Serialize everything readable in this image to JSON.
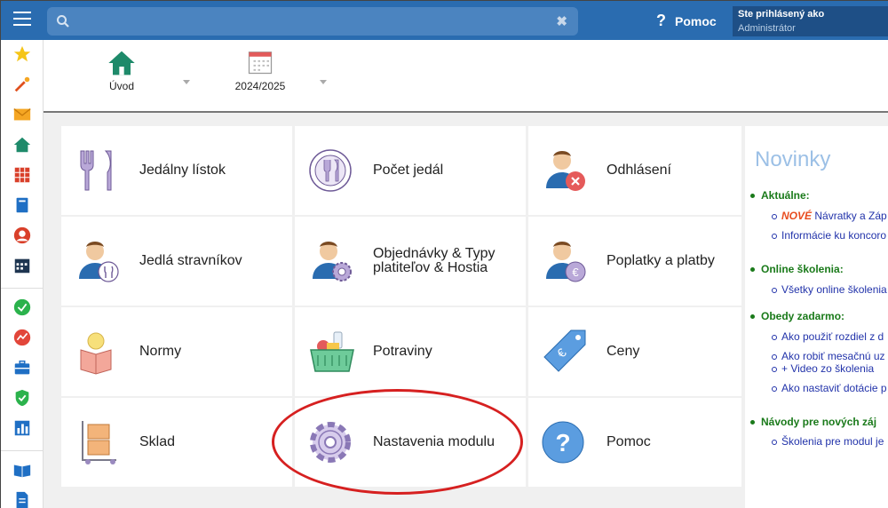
{
  "topbar": {
    "search_placeholder": "",
    "help_label": "Pomoc",
    "user_line1": "Ste prihlásený ako",
    "user_line2": "Administrátor"
  },
  "sidebar": {
    "icons": [
      "star-icon",
      "magic-wand-icon",
      "mail-icon",
      "home-icon",
      "grid-icon",
      "book-icon",
      "person-icon",
      "calendar-icon",
      "check-circle-icon",
      "chart-circle-icon",
      "briefcase-icon",
      "shield-check-icon",
      "bar-chart-icon",
      "open-book-icon",
      "document-icon"
    ]
  },
  "toolbar": {
    "items": [
      {
        "label": "Úvod"
      },
      {
        "label": "2024/2025"
      }
    ]
  },
  "tiles": [
    {
      "label": "Jedálny lístok"
    },
    {
      "label": "Počet jedál"
    },
    {
      "label": "Odhlásení"
    },
    {
      "label": "Jedlá stravníkov"
    },
    {
      "label": "Objednávky & Typy"
    },
    {
      "label": "platiteľov & Hostia"
    },
    {
      "label": "Poplatky a platby"
    },
    {
      "label": "Normy"
    },
    {
      "label": "Potraviny"
    },
    {
      "label": "Ceny"
    },
    {
      "label": "Sklad"
    },
    {
      "label": "Nastavenia modulu"
    },
    {
      "label": "Pomoc"
    }
  ],
  "news": {
    "title": "Novinky",
    "sections": [
      {
        "title": "Aktuálne:",
        "links": [
          {
            "badge": "NOVÉ",
            "text": "Návratky a Záp"
          },
          {
            "text": "Informácie ku koncoro"
          }
        ]
      },
      {
        "title": "Online školenia:",
        "links": [
          {
            "text": "Všetky online školenia"
          }
        ]
      },
      {
        "title": "Obedy zadarmo:",
        "links": [
          {
            "text": "Ako použiť rozdiel z d"
          },
          {
            "text": "Ako robiť mesačnú uz"
          },
          {
            "text": "+ Video zo školenia"
          },
          {
            "text": "Ako nastaviť dotácie p"
          }
        ]
      },
      {
        "title": "Návody pre nových záj",
        "links": [
          {
            "text": "Školenia pre modul je"
          }
        ]
      }
    ]
  },
  "colors": {
    "topbar": "#2a6cb0",
    "accent_green": "#1a7a1a",
    "link_blue": "#2233aa",
    "highlight_red": "#d62020"
  }
}
